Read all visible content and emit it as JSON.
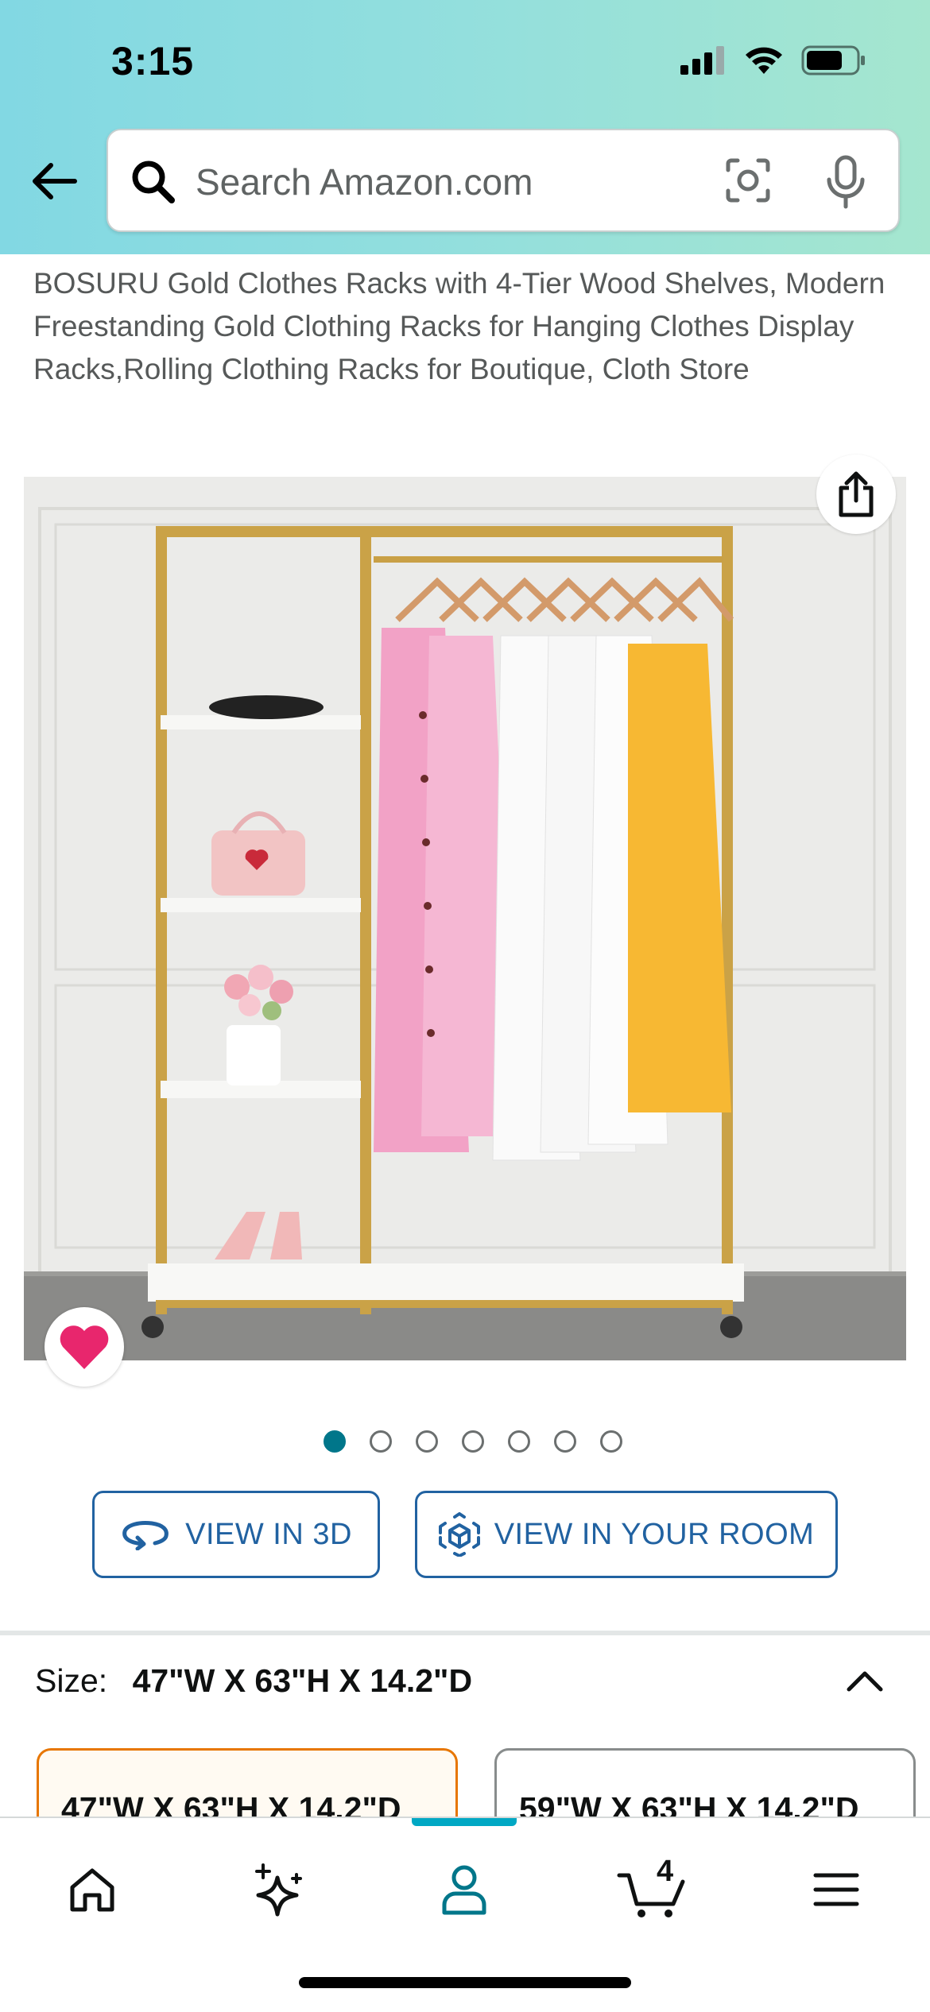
{
  "status_bar": {
    "time": "3:15"
  },
  "search": {
    "placeholder": "Search Amazon.com"
  },
  "product": {
    "title": "BOSURU Gold Clothes Racks with 4-Tier Wood Shelves, Modern Freestanding Gold Clothing Racks for Hanging Clothes Display Racks,Rolling Clothing Racks for Boutique, Cloth Store"
  },
  "gallery": {
    "image_count": 7,
    "current_index": 1
  },
  "buttons": {
    "view_3d": "VIEW IN 3D",
    "view_room": "VIEW IN YOUR ROOM"
  },
  "size": {
    "label": "Size:",
    "selected": "47\"W X 63\"H X 14.2\"D",
    "options": [
      "47\"W X 63\"H X 14.2\"D",
      "59\"W X 63\"H X 14.2\"D"
    ]
  },
  "nav": {
    "cart_count": "4",
    "active": "account"
  },
  "colors": {
    "accent": "#00768a",
    "link": "#2162a1",
    "selected_border": "#e77600",
    "wishlist": "#e8266d"
  },
  "icons": [
    "back-arrow-icon",
    "search-icon",
    "camera-icon",
    "mic-icon",
    "share-icon",
    "heart-icon",
    "rotate-3d-icon",
    "ar-cube-icon",
    "chevron-up-icon",
    "home-icon",
    "sparkle-icon",
    "person-icon",
    "cart-icon",
    "menu-icon"
  ]
}
